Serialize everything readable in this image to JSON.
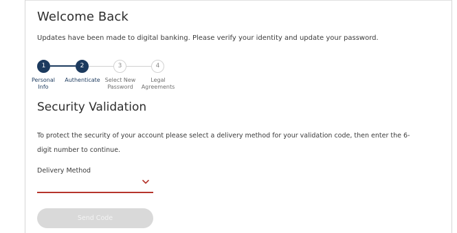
{
  "page": {
    "title": "Welcome Back",
    "intro": "Updates have been made to digital banking. Please verify your identity and update your password."
  },
  "stepper": {
    "current_step": 2,
    "steps": [
      {
        "number": "1",
        "label_line1": "Personal",
        "label_line2": "Info",
        "status": "complete"
      },
      {
        "number": "2",
        "label_line1": "Authenticate",
        "label_line2": "",
        "status": "current"
      },
      {
        "number": "3",
        "label_line1": "Select New",
        "label_line2": "Password",
        "status": "upcoming"
      },
      {
        "number": "4",
        "label_line1": "Legal",
        "label_line2": "Agreements",
        "status": "upcoming"
      }
    ]
  },
  "security": {
    "title": "Security Validation",
    "description": "To protect the security of your account please select a delivery method for your validation code, then enter the 6-digit number to continue.",
    "delivery_method": {
      "label": "Delivery Method",
      "value": "",
      "icon": "chevron-down-icon"
    },
    "send_button_label": "Send Code"
  },
  "colors": {
    "primary_navy": "#1c3a5e",
    "accent_red": "#b5342b",
    "disabled_button": "#d9d9d9"
  }
}
